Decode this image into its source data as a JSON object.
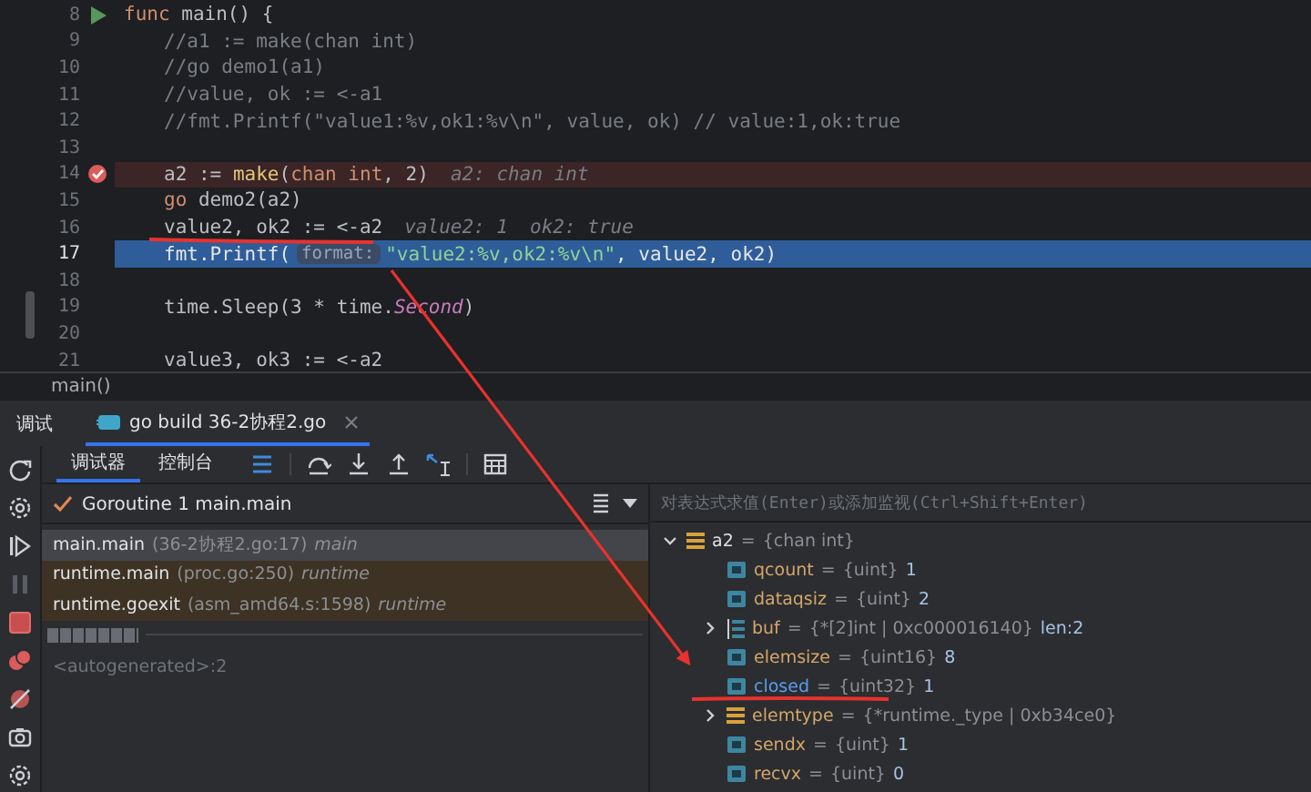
{
  "editor": {
    "lines": [
      {
        "number": "8",
        "runnable": true,
        "breakpoint": false,
        "current": false,
        "segments": [
          {
            "text": "func",
            "kind": "keyword"
          },
          {
            "text": " main() {",
            "kind": "plain"
          }
        ],
        "children": [
          {
            "number": "9",
            "breakpoint": false,
            "current": false,
            "segments": [
              {
                "text": "//a1 := make(chan int)",
                "kind": "comment"
              }
            ]
          },
          {
            "number": "10",
            "breakpoint": false,
            "current": false,
            "segments": [
              {
                "text": "//go demo1(a1)",
                "kind": "comment"
              }
            ]
          },
          {
            "number": "11",
            "breakpoint": false,
            "current": false,
            "segments": [
              {
                "text": "//value, ok := <-a1",
                "kind": "comment"
              }
            ]
          },
          {
            "number": "12",
            "breakpoint": false,
            "current": false,
            "segments": [
              {
                "text": "//fmt.Printf(\"value1:%v,ok1:%v\\n\", value, ok) // value:1,ok:true",
                "kind": "comment"
              }
            ]
          },
          {
            "number": "13",
            "breakpoint": false,
            "current": false
          },
          {
            "number": "14",
            "breakpoint": true,
            "current": false,
            "segments": [
              {
                "text": "a2 := ",
                "kind": "plain"
              },
              {
                "text": "make",
                "kind": "builtin"
              },
              {
                "text": "(",
                "kind": "plain"
              },
              {
                "text": "chan int",
                "kind": "keyword"
              },
              {
                "text": ", 2)",
                "kind": "plain"
              },
              {
                "text": "a2: chan int",
                "kind": "hint"
              }
            ]
          },
          {
            "number": "15",
            "breakpoint": false,
            "current": false,
            "segments": [
              {
                "text": "go",
                "kind": "keyword"
              },
              {
                "text": " demo2(a2)",
                "kind": "plain"
              }
            ]
          },
          {
            "number": "16",
            "breakpoint": false,
            "current": false,
            "segments": [
              {
                "text": "value2, ok2 := <-a2",
                "kind": "plain"
              },
              {
                "text": "value2: 1",
                "kind": "hint"
              },
              {
                "text": "ok2: true",
                "kind": "hint"
              }
            ]
          },
          {
            "number": "17",
            "breakpoint": false,
            "current": true,
            "segments": [
              {
                "text": "fmt.Printf(",
                "kind": "plain"
              },
              {
                "text": "format:",
                "kind": "param"
              },
              {
                "text": "\"value2:%v,ok2:%v\\n\"",
                "kind": "string"
              },
              {
                "text": ", value2, ok2)",
                "kind": "plain"
              }
            ]
          },
          {
            "number": "18",
            "breakpoint": false,
            "current": false
          },
          {
            "number": "19",
            "breakpoint": false,
            "current": false,
            "segments": [
              {
                "text": "time.Sleep(3 * time.",
                "kind": "plain"
              },
              {
                "text": "Second",
                "kind": "constant"
              },
              {
                "text": ")",
                "kind": "plain"
              }
            ]
          },
          {
            "number": "20",
            "breakpoint": false,
            "current": false
          },
          {
            "number": "21",
            "breakpoint": false,
            "current": false,
            "segments": [
              {
                "text": "value3, ok3 := <-a2",
                "kind": "plain"
              }
            ]
          }
        ]
      }
    ],
    "breadcrumb": "main()"
  },
  "debug": {
    "title": "调试",
    "tabs": [
      {
        "label": "go build 36-2协程2.go",
        "selected": true
      }
    ],
    "subtabs": [
      {
        "label": "调试器",
        "selected": true
      },
      {
        "label": "控制台",
        "selected": false
      }
    ],
    "goroutine": {
      "label": "Goroutine 1 main.main"
    },
    "frames": [
      {
        "name": "main.main",
        "location": "(36-2协程2.go:17)",
        "package": "main",
        "selected": true,
        "kind": "user"
      },
      {
        "name": "runtime.main",
        "location": "(proc.go:250)",
        "package": "runtime",
        "selected": false,
        "kind": "library"
      },
      {
        "name": "runtime.goexit",
        "location": "(asm_amd64.s:1598)",
        "package": "runtime",
        "selected": false,
        "kind": "library"
      }
    ],
    "autogenerated": "<autogenerated>:2",
    "eval": {
      "placeholder": "对表达式求值(Enter)或添加监视(Ctrl+Shift+Enter)"
    },
    "variables": [
      {
        "name": "a2",
        "operator": "=",
        "type": "{chan int}",
        "kind": "struct",
        "expanded": true,
        "children": [
          {
            "name": "qcount",
            "operator": "=",
            "type": "{uint}",
            "value": "1",
            "kind": "field",
            "changed": false
          },
          {
            "name": "dataqsiz",
            "operator": "=",
            "type": "{uint}",
            "value": "2",
            "kind": "field",
            "changed": false
          },
          {
            "name": "buf",
            "operator": "=",
            "type": "{*[2]int | 0xc000016140}",
            "value": "len:2",
            "kind": "array",
            "expanded": false,
            "changed": false
          },
          {
            "name": "elemsize",
            "operator": "=",
            "type": "{uint16}",
            "value": "8",
            "kind": "field",
            "changed": false
          },
          {
            "name": "closed",
            "operator": "=",
            "type": "{uint32}",
            "value": "1",
            "kind": "field",
            "changed": true
          },
          {
            "name": "elemtype",
            "operator": "=",
            "type": "{*runtime._type | 0xb34ce0}",
            "kind": "struct",
            "expanded": false,
            "changed": false
          },
          {
            "name": "sendx",
            "operator": "=",
            "type": "{uint}",
            "value": "1",
            "kind": "field",
            "changed": false
          },
          {
            "name": "recvx",
            "operator": "=",
            "type": "{uint}",
            "value": "0",
            "kind": "field",
            "changed": false
          }
        ]
      }
    ]
  }
}
